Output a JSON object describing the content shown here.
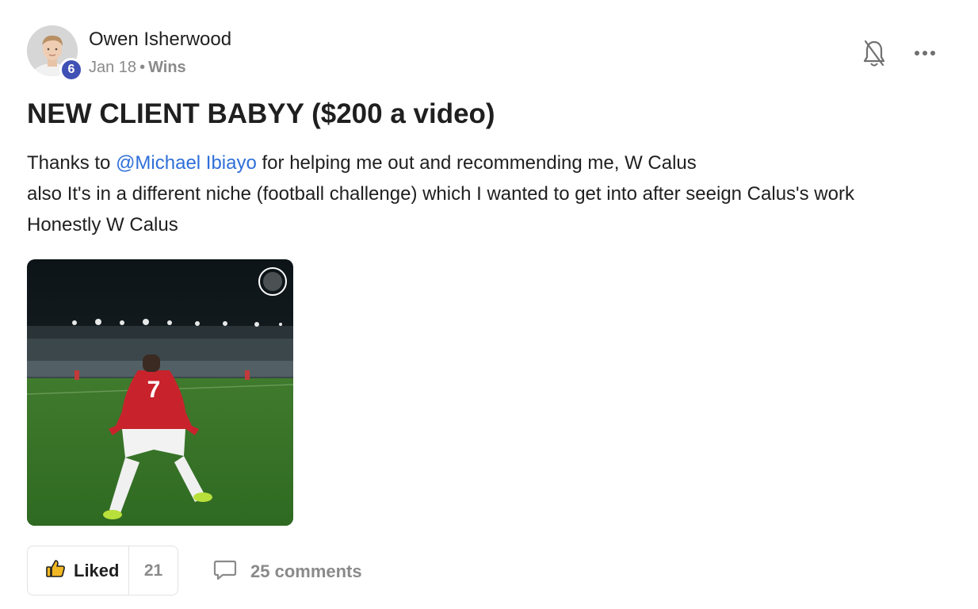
{
  "post": {
    "author": {
      "name": "Owen Isherwood",
      "level": "6"
    },
    "date": "Jan 18",
    "separator": "•",
    "category": "Wins",
    "title": "NEW CLIENT BABYY ($200 a video)",
    "body": {
      "line1_prefix": "Thanks to ",
      "mention": "@Michael Ibiayo",
      "line1_suffix": " for helping me out and recommending me, W Calus",
      "line2": "also It's in a different niche (football challenge) which I wanted to get into after seeign Calus's work",
      "line3": "Honestly W Calus"
    },
    "media": {
      "jersey_number": "7"
    }
  },
  "actions": {
    "like_label": "Liked",
    "like_count": "21",
    "comments_label": "25 comments"
  },
  "icons": {
    "bell": "bell-off-icon",
    "more": "more-horizontal-icon",
    "like": "thumbs-up-icon",
    "comment": "comment-bubble-icon"
  },
  "colors": {
    "accent_link": "#2f6fd8",
    "level_badge": "#3f51b5",
    "muted_text": "#8a8a8a",
    "like_icon": "#f2b824"
  }
}
